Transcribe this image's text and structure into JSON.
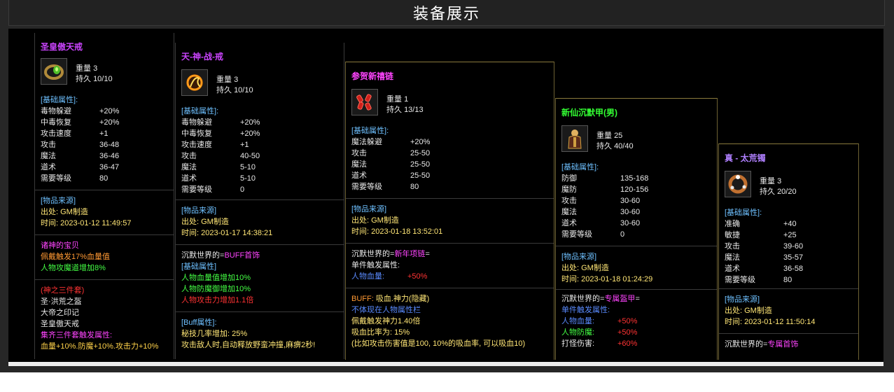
{
  "page": {
    "title": "装备展示"
  },
  "cards": {
    "c1": {
      "name": "圣皇傲天戒",
      "icon": "ring-icon",
      "weight_label": "重量",
      "weight": "3",
      "durability_label": "持久",
      "durability": "10/10",
      "base_header": "[基础属性]:",
      "stats": [
        {
          "k": "毒物躲避",
          "v": "+20%"
        },
        {
          "k": "中毒恢复",
          "v": "+20%"
        },
        {
          "k": "攻击速度",
          "v": "+1"
        },
        {
          "k": "攻击",
          "v": "36-48"
        },
        {
          "k": "魔法",
          "v": "36-46"
        },
        {
          "k": "道术",
          "v": "36-47"
        },
        {
          "k": "需要等级",
          "v": "80"
        }
      ],
      "source_header": "[物品来源]",
      "origin": "出处: GM制造",
      "time": "时间: 2023-01-12 11:49:57",
      "extra1": "诸神的宝贝",
      "extra2": "佩戴触发17%血量值",
      "extra3": "人物攻魔道增加8%",
      "set_title": "(神之三件套)",
      "set_item1": "圣·洪荒之盔",
      "set_item2": "大帝之印记",
      "set_item3": "圣皇傲天戒",
      "set_trigger": "集齐三件套触发属性:",
      "set_bonus": "血量+10%.防魔+10%.攻击力+10%"
    },
    "c2": {
      "name": "天-神-战-戒",
      "icon": "fire-ring-icon",
      "weight_label": "重量",
      "weight": "3",
      "durability_label": "持久",
      "durability": "10/10",
      "base_header": "[基础属性]:",
      "stats": [
        {
          "k": "毒物躲避",
          "v": "+20%"
        },
        {
          "k": "中毒恢复",
          "v": "+20%"
        },
        {
          "k": "攻击速度",
          "v": "+1"
        },
        {
          "k": "攻击",
          "v": "40-50"
        },
        {
          "k": "魔法",
          "v": "5-10"
        },
        {
          "k": "道术",
          "v": "5-10"
        },
        {
          "k": "需要等级",
          "v": "0"
        }
      ],
      "source_header": "[物品来源]",
      "origin": "出处: GM制造",
      "time": "时间: 2023-01-17 14:38:21",
      "world_prefix": "沉默世界的=",
      "world_item": "BUFF首饰",
      "base2_header": "[基础属性]",
      "base2_1": "人物血量值增加10%",
      "base2_2": "人物防魔御增加10%",
      "base2_3": "人物攻击力增加1.1倍",
      "buff_header": "[Buff属性]:",
      "buff_1": "秘技几率增加: 25%",
      "buff_2": "攻击敌人时,自动释放野蛮冲撞,麻痹2秒!"
    },
    "c3": {
      "name": "参贺新禧链",
      "icon": "firecracker-icon",
      "weight_label": "重量",
      "weight": "1",
      "durability_label": "持久",
      "durability": "13/13",
      "base_header": "[基础属性]:",
      "stats": [
        {
          "k": "魔法躲避",
          "v": "+20%"
        },
        {
          "k": "攻击",
          "v": "25-50"
        },
        {
          "k": "魔法",
          "v": "25-50"
        },
        {
          "k": "道术",
          "v": "25-50"
        },
        {
          "k": "需要等级",
          "v": "80"
        }
      ],
      "source_header": "[物品来源]",
      "origin": "出处: GM制造",
      "time": "时间: 2023-01-18 13:52:01",
      "world_prefix": "沉默世界的=",
      "world_item": "新年项链",
      "world_suffix": "=",
      "single_trigger": "单件触发属性:",
      "hp_label": "人物血量:",
      "hp_value": "+50%",
      "buff_prefix": "BUFF:",
      "buff_name": "吸血.神力(隐藏)",
      "buff_hidden": "不体现在人物属性栏",
      "buff_l1": "佩戴触发神力1.40倍",
      "buff_l2": "吸血比率为: 15%",
      "buff_l3": "(比如攻击伤害值是100, 10%的吸血率, 可以吸血10)"
    },
    "c4": {
      "name": "新仙沉默甲(男)",
      "icon": "armor-icon",
      "weight_label": "重量",
      "weight": "25",
      "durability_label": "持久",
      "durability": "40/40",
      "base_header": "[基础属性]:",
      "stats": [
        {
          "k": "防御",
          "v": "135-168"
        },
        {
          "k": "魔防",
          "v": "120-156"
        },
        {
          "k": "攻击",
          "v": "30-60"
        },
        {
          "k": "魔法",
          "v": "30-60"
        },
        {
          "k": "道术",
          "v": "30-60"
        },
        {
          "k": "需要等级",
          "v": "0"
        }
      ],
      "source_header": "[物品来源]",
      "origin": "出处: GM制造",
      "time": "时间: 2023-01-18 01:24:29",
      "world_prefix": "沉默世界的=",
      "world_item": "专属盔甲",
      "world_suffix": "=",
      "single_trigger": "单件触发属性:",
      "r1_k": "人物血量:",
      "r1_v": "+50%",
      "r2_k": "人物防魔:",
      "r2_v": "+50%",
      "r3_k": "打怪伤害:",
      "r3_v": "+60%"
    },
    "c5": {
      "name": "真 - 太荒镯",
      "icon": "bracelet-icon",
      "weight_label": "重量",
      "weight": "3",
      "durability_label": "持久",
      "durability": "20/20",
      "base_header": "[基础属性]:",
      "stats": [
        {
          "k": "准确",
          "v": "+40"
        },
        {
          "k": "敏捷",
          "v": "+25"
        },
        {
          "k": "攻击",
          "v": "39-60"
        },
        {
          "k": "魔法",
          "v": "35-57"
        },
        {
          "k": "道术",
          "v": "36-58"
        },
        {
          "k": "需要等级",
          "v": "80"
        }
      ],
      "source_header": "[物品来源]",
      "origin": "出处: GM制造",
      "time": "时间: 2023-01-12 11:50:14",
      "world_prefix": "沉默世界的=",
      "world_item": "专属首饰"
    }
  }
}
